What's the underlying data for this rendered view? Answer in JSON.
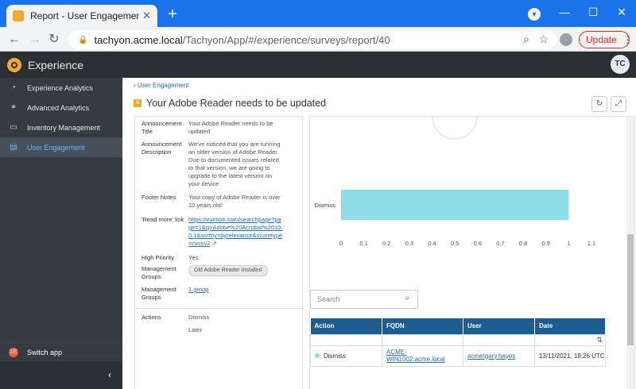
{
  "browser": {
    "tab_title": "Report - User Engagement - Expe",
    "url_host": "tachyon.acme.local",
    "url_path": "/Tachyon/App/#/experience/surveys/report/40",
    "update_label": "Update",
    "window_controls": [
      "—",
      "☐",
      "✕"
    ]
  },
  "app": {
    "title": "Experience",
    "user_initials": "TC",
    "accent_color": "#f0a830"
  },
  "sidebar": {
    "items": [
      {
        "label": "Experience Analytics",
        "icon": "gauge-icon"
      },
      {
        "label": "Advanced Analytics",
        "icon": "binoculars-icon"
      },
      {
        "label": "Inventory Management",
        "icon": "monitor-icon"
      },
      {
        "label": "User Engagement",
        "icon": "clipboard-icon",
        "active": true
      }
    ],
    "switch_app": "Switch app",
    "collapse_glyph": "‹"
  },
  "page": {
    "breadcrumb": "‹ User Engagement",
    "title": "Your Adobe Reader needs to be updated",
    "badge": "A"
  },
  "details": [
    {
      "label": "Announcement Title",
      "value": "Your Adobe Reader needs to be updated"
    },
    {
      "label": "Announcement Description",
      "value": "We've noticed that you are running an older version of Adobe Reader. Due to documented issues related to that version, we are going to upgrade to the latest version on your device."
    },
    {
      "label": "Footer Notes",
      "value": "Your copy of Adobe Reader is over 10 years old!"
    },
    {
      "label": "'Read more' link",
      "value": "https://vulmon.com/searchpage?page=1&q=Adobe%20Acrobat%2010.0.1&sortby=byrelevance&scoretype=cvssv2"
    },
    {
      "label": "High Priority",
      "value": "Yes"
    },
    {
      "label": "Management Groups",
      "value": "Old Adobe Reader Installed"
    },
    {
      "label": "Management Groups",
      "value": "1 group"
    }
  ],
  "actions": {
    "label": "Actions",
    "values": [
      "Dismiss",
      "Later"
    ]
  },
  "chart_data": {
    "type": "bar",
    "orientation": "horizontal",
    "categories": [
      "Dismiss"
    ],
    "values": [
      1
    ],
    "xlim": [
      0,
      1.1
    ],
    "xticks": [
      0,
      0.1,
      0.2,
      0.3,
      0.4,
      0.5,
      0.6,
      0.7,
      0.8,
      0.9,
      1,
      1.1
    ],
    "bar_color": "#8ddde8",
    "grid": false
  },
  "search": {
    "placeholder": "Search"
  },
  "table": {
    "headers": [
      "Action",
      "FQDN",
      "User",
      "Date"
    ],
    "rows": [
      {
        "action": "Dismiss",
        "fqdn": "ACME-WIN1002.acme.local",
        "user": "acme\\gary.hayes",
        "date": "13/11/2021, 18:26 UTC"
      }
    ]
  }
}
